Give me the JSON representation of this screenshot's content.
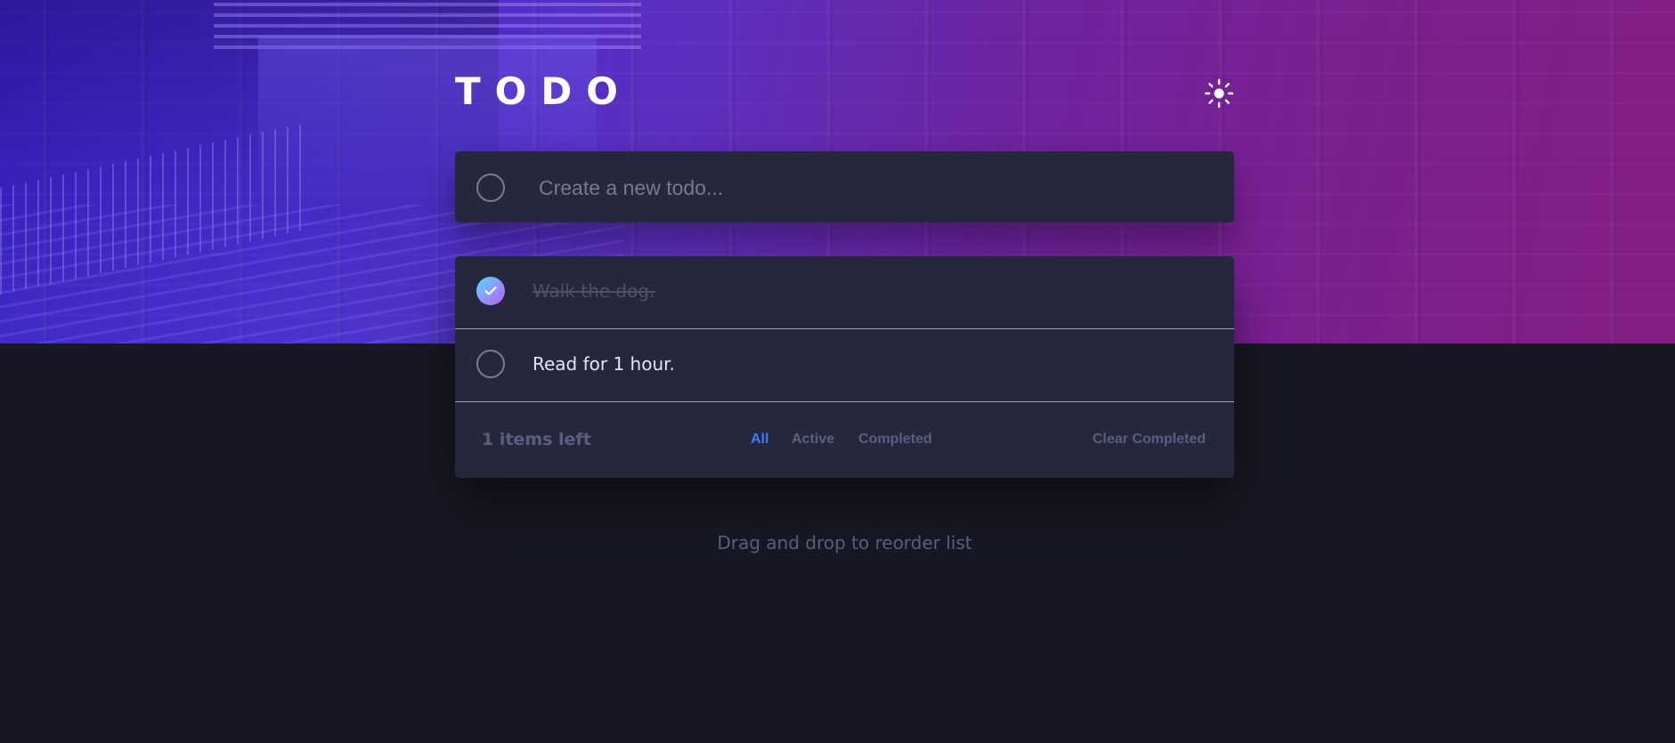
{
  "header": {
    "title": "TODO",
    "theme_toggle_icon": "sun-icon"
  },
  "new_todo": {
    "placeholder": "Create a new todo...",
    "value": ""
  },
  "todos": [
    {
      "text": "Walk the dog.",
      "completed": true
    },
    {
      "text": "Read for 1 hour.",
      "completed": false
    }
  ],
  "footer": {
    "items_left": "1 items left",
    "filters": [
      {
        "label": "All",
        "active": true
      },
      {
        "label": "Active",
        "active": false
      },
      {
        "label": "Completed",
        "active": false
      }
    ],
    "clear_label": "Clear Completed"
  },
  "hint": "Drag and drop to reorder list",
  "colors": {
    "background": "#171823",
    "card": "#25273d",
    "active_filter": "#3a7cfd",
    "check_gradient_start": "#55ddff",
    "check_gradient_end": "#c058f3",
    "muted_text": "#5b5e7e",
    "todo_text": "#e4e5f1"
  }
}
